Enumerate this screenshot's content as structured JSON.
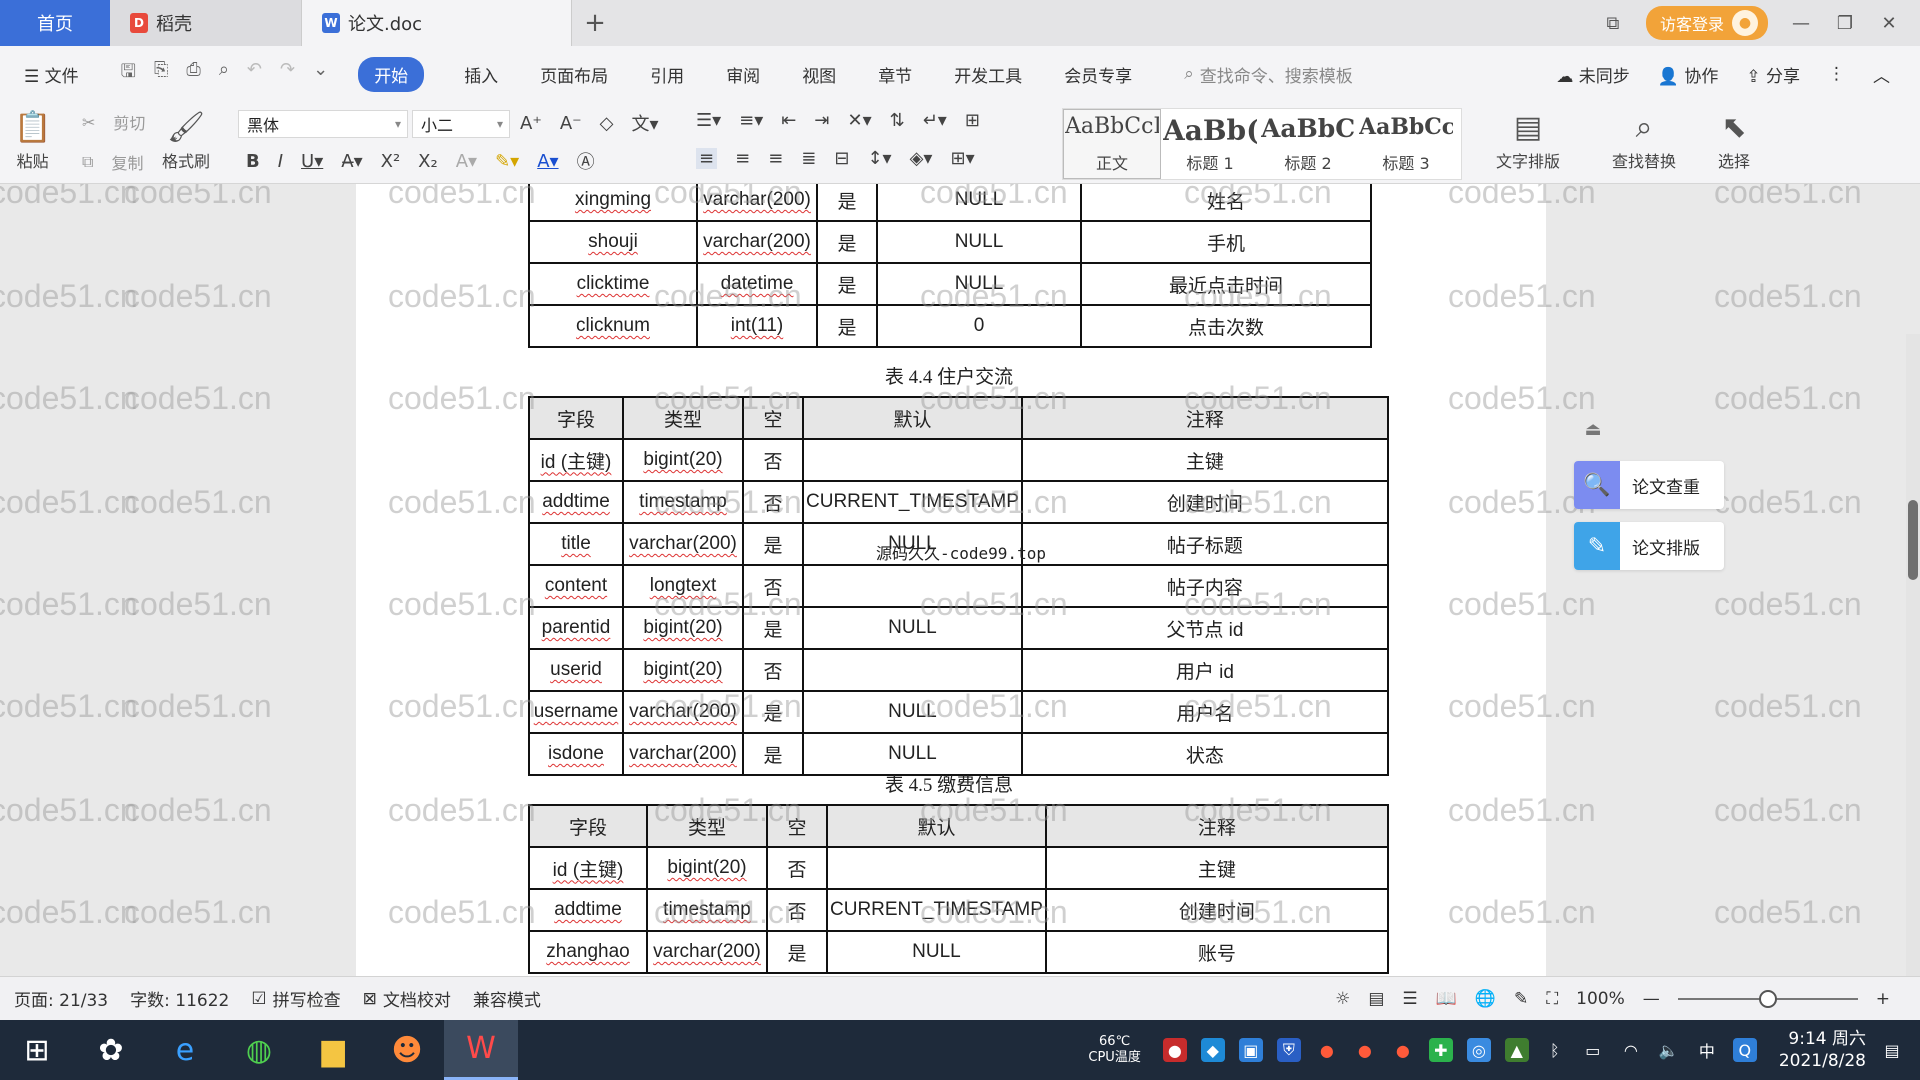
{
  "titlebar": {
    "home_tab": "首页",
    "tabs": [
      {
        "label": "稻壳",
        "icon": "docer-icon"
      },
      {
        "label": "论文.doc",
        "icon": "word-doc-icon"
      }
    ],
    "add_tab": "+",
    "login_label": "访客登录"
  },
  "menu": {
    "file": "文件",
    "items": [
      "开始",
      "插入",
      "页面布局",
      "引用",
      "审阅",
      "视图",
      "章节",
      "开发工具",
      "会员专享"
    ],
    "search_placeholder": "查找命令、搜索模板",
    "sync": "未同步",
    "collab": "协作",
    "share": "分享"
  },
  "ribbon": {
    "paste": "粘贴",
    "cut": "剪切",
    "copy": "复制",
    "format_painter": "格式刷",
    "font_name": "黑体",
    "font_size": "小二",
    "styles": [
      {
        "sample": "AaBbCcI",
        "label": "正文"
      },
      {
        "sample": "AaBb(",
        "label": "标题 1"
      },
      {
        "sample": "AaBbC",
        "label": "标题 2"
      },
      {
        "sample": "AaBbCcI",
        "label": "标题 3"
      }
    ],
    "text_layout": "文字排版",
    "find_replace": "查找替换",
    "select": "选择"
  },
  "document": {
    "table_top_rows": [
      [
        "xingming",
        "varchar(200)",
        "是",
        "NULL",
        "姓名"
      ],
      [
        "shouji",
        "varchar(200)",
        "是",
        "NULL",
        "手机"
      ],
      [
        "clicktime",
        "datetime",
        "是",
        "NULL",
        "最近点击时间"
      ],
      [
        "clicknum",
        "int(11)",
        "是",
        "0",
        "点击次数"
      ]
    ],
    "caption_44": "表 4.4 住户交流",
    "header": [
      "字段",
      "类型",
      "空",
      "默认",
      "注释"
    ],
    "table_44_rows": [
      [
        "id (主键)",
        "bigint(20)",
        "否",
        "",
        "主键"
      ],
      [
        "addtime",
        "timestamp",
        "否",
        "CURRENT_TIMESTAMP",
        "创建时间"
      ],
      [
        "title",
        "varchar(200)",
        "是",
        "NULL",
        "帖子标题"
      ],
      [
        "content",
        "longtext",
        "否",
        "",
        "帖子内容"
      ],
      [
        "parentid",
        "bigint(20)",
        "是",
        "NULL",
        "父节点 id"
      ],
      [
        "userid",
        "bigint(20)",
        "否",
        "",
        "用户 id"
      ],
      [
        "username",
        "varchar(200)",
        "是",
        "NULL",
        "用户名"
      ],
      [
        "isdone",
        "varchar(200)",
        "是",
        "NULL",
        "状态"
      ]
    ],
    "caption_45": "表 4.5 缴费信息",
    "table_45_rows": [
      [
        "id (主键)",
        "bigint(20)",
        "否",
        "",
        "主键"
      ],
      [
        "addtime",
        "timestamp",
        "否",
        "CURRENT_TIMESTAMP",
        "创建时间"
      ],
      [
        "zhanghao",
        "varchar(200)",
        "是",
        "NULL",
        "账号"
      ]
    ],
    "overlay": "源码久久-code99.top",
    "watermark": "code51.cn"
  },
  "side_panel": {
    "check": "论文查重",
    "layout": "论文排版"
  },
  "statusbar": {
    "page": "页面: 21/33",
    "words": "字数: 11622",
    "spell": "拼写检查",
    "proof": "文档校对",
    "compat": "兼容模式",
    "zoom": "100%",
    "zoom_level": 0.5
  },
  "taskbar": {
    "temp": "66℃",
    "cpu_label": "CPU温度",
    "time": "9:14 周六",
    "date": "2021/8/28",
    "ime": "中"
  }
}
